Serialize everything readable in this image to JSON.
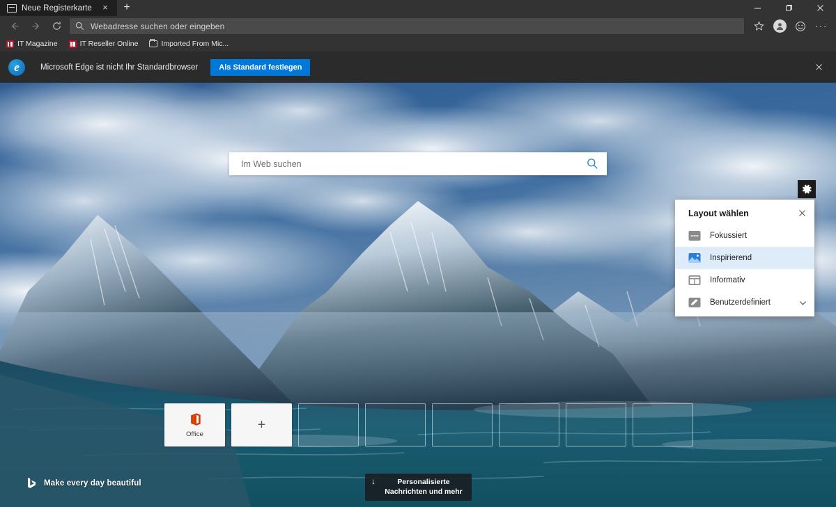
{
  "window": {
    "minimize_label": "Minimieren",
    "maximize_label": "Maximieren",
    "close_label": "Schließen"
  },
  "tabs": [
    {
      "title": "Neue Registerkarte",
      "close_label": "×"
    }
  ],
  "newtab_button_label": "+",
  "toolbar": {
    "back_label": "Zurück",
    "forward_label": "Vorwärts",
    "refresh_label": "Aktualisieren",
    "address_placeholder": "Webadresse suchen oder eingeben",
    "favorites_label": "Favoriten",
    "profile_label": "Profil",
    "feedback_label": "Feedback",
    "more_label": "···"
  },
  "bookmarks": [
    {
      "label": "IT Magazine",
      "icon": "red-magazine-icon"
    },
    {
      "label": "IT Reseller Online",
      "icon": "red-magazine-icon"
    },
    {
      "label": "Imported From Mic...",
      "icon": "folder-icon"
    }
  ],
  "notification": {
    "logo": "edge-logo",
    "message": "Microsoft Edge ist nicht Ihr Standardbrowser",
    "button_label": "Als Standard festlegen",
    "close_label": "×"
  },
  "newtab": {
    "search_placeholder": "Im Web suchen",
    "tiles": [
      {
        "label": "Office",
        "type": "filled",
        "icon": "office-icon"
      },
      {
        "label": "+",
        "type": "filled",
        "icon": "plus-icon"
      },
      {
        "label": "",
        "type": "empty",
        "icon": ""
      },
      {
        "label": "",
        "type": "empty",
        "icon": ""
      },
      {
        "label": "",
        "type": "empty",
        "icon": ""
      },
      {
        "label": "",
        "type": "empty",
        "icon": ""
      },
      {
        "label": "",
        "type": "empty",
        "icon": ""
      },
      {
        "label": "",
        "type": "empty",
        "icon": ""
      }
    ],
    "bing_attribution": "Make every day beautiful",
    "news_pill": {
      "arrow": "↓",
      "label": "Personalisierte Nachrichten und mehr"
    }
  },
  "layout_panel": {
    "gear_label": "Einstellungen",
    "title": "Layout wählen",
    "close_label": "×",
    "selected": "Inspirierend",
    "items": [
      {
        "label": "Fokussiert",
        "icon": "focused-layout-icon",
        "selected": false,
        "expandable": false
      },
      {
        "label": "Inspirierend",
        "icon": "inspirational-layout-icon",
        "selected": true,
        "expandable": false
      },
      {
        "label": "Informativ",
        "icon": "informational-layout-icon",
        "selected": false,
        "expandable": false
      },
      {
        "label": "Benutzerdefiniert",
        "icon": "custom-layout-icon",
        "selected": false,
        "expandable": true
      }
    ]
  },
  "colors": {
    "chrome_bg": "#333333",
    "tab_active_bg": "#1f1f1f",
    "notification_bg": "#2b2b2b",
    "accent_blue": "#0078d7",
    "selected_row_bg": "#deecf9",
    "search_icon_blue": "#1673c4",
    "office_orange": "#d83b01"
  }
}
